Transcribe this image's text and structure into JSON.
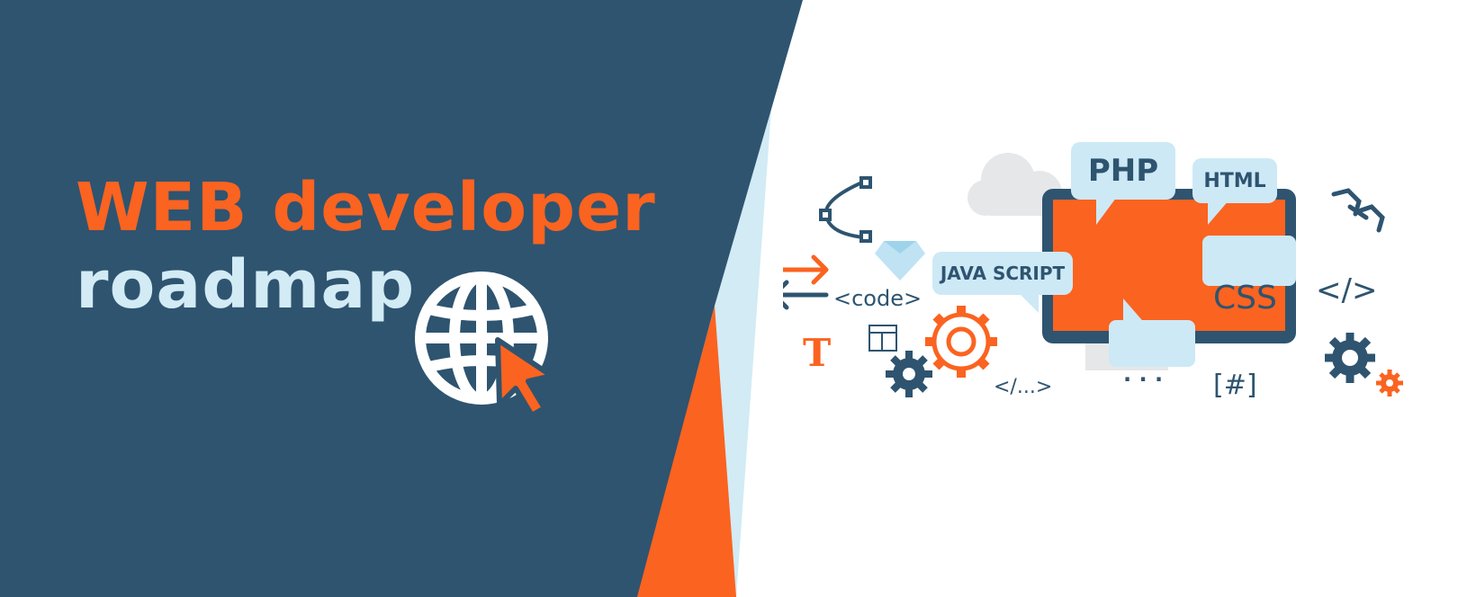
{
  "headline": {
    "line1": "WEB developer",
    "line2": "roadmap"
  },
  "colors": {
    "navy": "#2e5470",
    "orange": "#fb6320",
    "light_blue": "#d2ebf5",
    "bubble_blue": "#cde9f6"
  },
  "illustration": {
    "php_label": "PHP",
    "html_label": "HTML",
    "javascript_label": "JAVA SCRIPT",
    "css_label": "CSS",
    "code_tag": "<code>",
    "close_tag": "</>",
    "ellipsis_tag": "</...>",
    "hash_tag": "[#]",
    "type_glyph": "T",
    "dots": "· · ·"
  },
  "icons": [
    "globe-cursor-icon",
    "bezier-curve-icon",
    "diamond-icon",
    "swap-arrows-icon",
    "cloud-icon",
    "monitor-icon",
    "gear-icon",
    "chain-link-icon",
    "layout-icon"
  ]
}
